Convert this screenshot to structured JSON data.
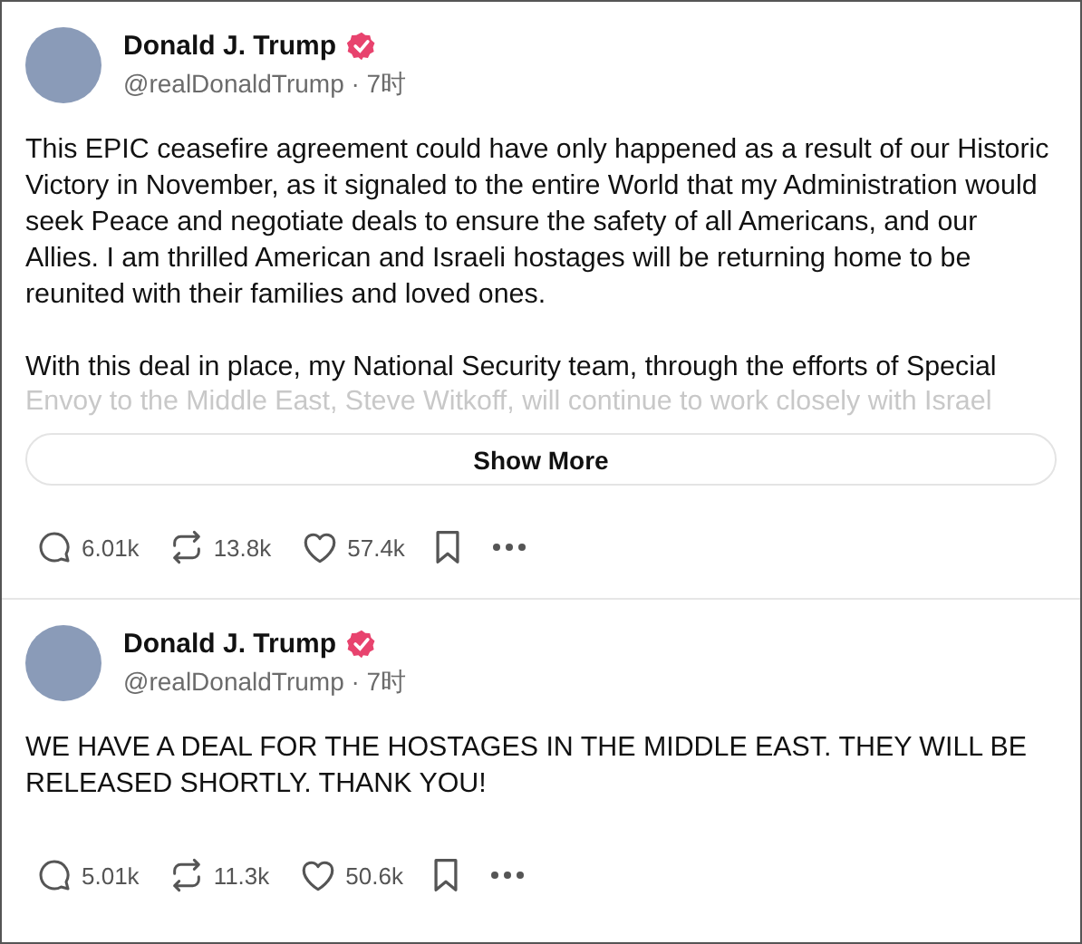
{
  "posts": [
    {
      "author": {
        "name": "Donald J. Trump",
        "verified": true,
        "meta": "@realDonaldTrump · 7时"
      },
      "blocks": [
        {
          "kind": "paragraph",
          "text": "This EPIC ceasefire agreement could have only happened as a result of our Historic Victory in November, as it signaled to the entire World that my Administration would seek Peace and negotiate deals to ensure the safety of all Americans, and our Allies. I am thrilled American and Israeli hostages will be returning home to be reunited with their families and loved ones."
        },
        {
          "kind": "paragraph",
          "text": "With this deal in place, my National Security team, through the efforts of Special"
        },
        {
          "kind": "faded",
          "text": "Envoy to the Middle East, Steve Witkoff, will continue to work closely with Israel"
        }
      ],
      "show_more": "Show More",
      "stats": {
        "replies": "6.01k",
        "reposts": "13.8k",
        "likes": "57.4k"
      }
    },
    {
      "author": {
        "name": "Donald J. Trump",
        "verified": true,
        "meta": "@realDonaldTrump · 7时"
      },
      "blocks": [
        {
          "kind": "paragraph",
          "text": "WE HAVE A DEAL FOR THE HOSTAGES IN THE MIDDLE EAST. THEY WILL BE RELEASED SHORTLY. THANK YOU!"
        }
      ],
      "stats": {
        "replies": "5.01k",
        "reposts": "11.3k",
        "likes": "50.6k"
      }
    }
  ]
}
